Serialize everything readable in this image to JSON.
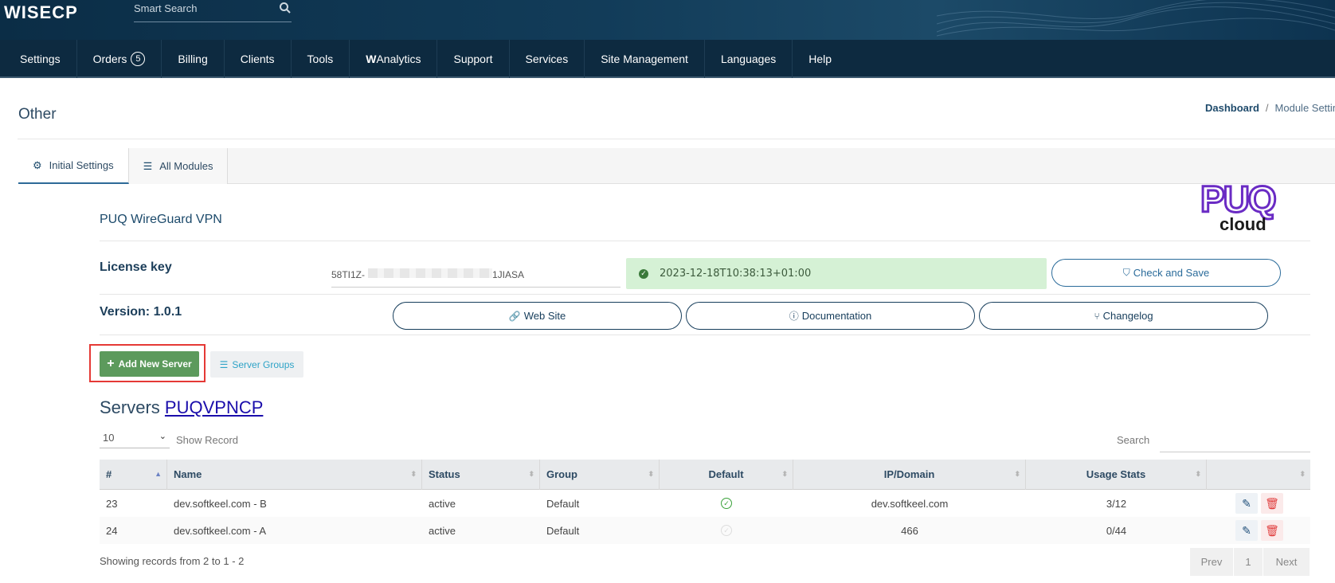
{
  "header": {
    "logo_text": "WISECP",
    "search_placeholder": "Smart Search"
  },
  "nav": {
    "items": [
      {
        "label": "Settings"
      },
      {
        "label": "Orders",
        "badge": "5"
      },
      {
        "label": "Billing"
      },
      {
        "label": "Clients"
      },
      {
        "label": "Tools"
      },
      {
        "label": "WAnalytics",
        "bold_prefix": "W",
        "rest": "Analytics"
      },
      {
        "label": "Support"
      },
      {
        "label": "Services"
      },
      {
        "label": "Site Management"
      },
      {
        "label": "Languages"
      },
      {
        "label": "Help"
      }
    ]
  },
  "page": {
    "title": "Other",
    "breadcrumb": {
      "home": "Dashboard",
      "separator": "/",
      "current": "Module Settin"
    }
  },
  "tabs": [
    {
      "label": "Initial Settings",
      "icon": "cogs-icon",
      "active": true
    },
    {
      "label": "All Modules",
      "icon": "list-icon",
      "active": false
    }
  ],
  "module": {
    "name": "PUQ WireGuard VPN",
    "logo_line1": "PUQ",
    "logo_line2": "cloud",
    "license_label": "License key",
    "license_value_start": "58TI1Z-",
    "license_value_end": "-1JIASA",
    "license_status": "2023-12-18T10:38:13+01:00",
    "check_save_label": "Check and Save",
    "version_label": "Version: 1.0.1",
    "website_label": "Web Site",
    "documentation_label": "Documentation",
    "changelog_label": "Changelog"
  },
  "actions": {
    "add_server_label": "Add New Server",
    "server_groups_label": "Server Groups"
  },
  "servers": {
    "title_prefix": "Servers",
    "title_link": "PUQVPNCP",
    "page_length": "10",
    "show_record_label": "Show Record",
    "search_label": "Search",
    "columns": [
      "#",
      "Name",
      "Status",
      "Group",
      "Default",
      "IP/Domain",
      "Usage Stats",
      ""
    ],
    "rows": [
      {
        "id": "23",
        "name": "dev.softkeel.com - B",
        "status": "active",
        "group": "Default",
        "default": true,
        "ip": "dev.softkeel.com",
        "usage": "3/12"
      },
      {
        "id": "24",
        "name": "dev.softkeel.com - A",
        "status": "active",
        "group": "Default",
        "default": false,
        "ip": "466",
        "usage": "0/44"
      }
    ],
    "showing_text": "Showing records from 2 to 1 - 2",
    "pager": {
      "prev": "Prev",
      "page": "1",
      "next": "Next"
    }
  },
  "colors": {
    "nav_bg": "#0d2a40",
    "accent": "#2a6b9a",
    "success_bg": "#d5f1d5",
    "add_button": "#5c9a5c",
    "highlight": "#e53935"
  }
}
